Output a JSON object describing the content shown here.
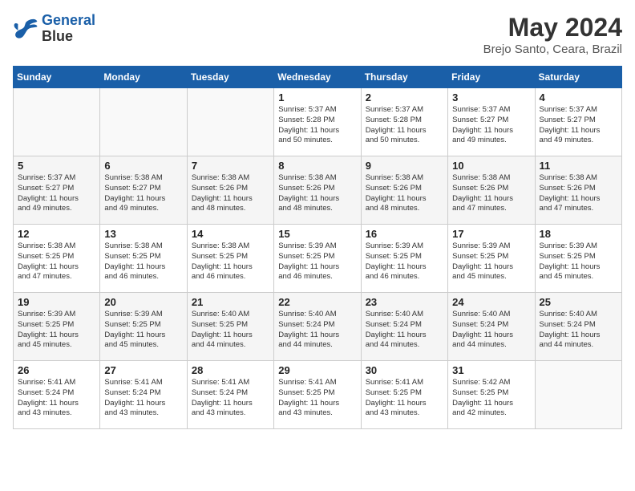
{
  "header": {
    "logo_line1": "General",
    "logo_line2": "Blue",
    "month": "May 2024",
    "location": "Brejo Santo, Ceara, Brazil"
  },
  "days_of_week": [
    "Sunday",
    "Monday",
    "Tuesday",
    "Wednesday",
    "Thursday",
    "Friday",
    "Saturday"
  ],
  "weeks": [
    [
      {
        "day": "",
        "content": ""
      },
      {
        "day": "",
        "content": ""
      },
      {
        "day": "",
        "content": ""
      },
      {
        "day": "1",
        "content": "Sunrise: 5:37 AM\nSunset: 5:28 PM\nDaylight: 11 hours\nand 50 minutes."
      },
      {
        "day": "2",
        "content": "Sunrise: 5:37 AM\nSunset: 5:28 PM\nDaylight: 11 hours\nand 50 minutes."
      },
      {
        "day": "3",
        "content": "Sunrise: 5:37 AM\nSunset: 5:27 PM\nDaylight: 11 hours\nand 49 minutes."
      },
      {
        "day": "4",
        "content": "Sunrise: 5:37 AM\nSunset: 5:27 PM\nDaylight: 11 hours\nand 49 minutes."
      }
    ],
    [
      {
        "day": "5",
        "content": "Sunrise: 5:37 AM\nSunset: 5:27 PM\nDaylight: 11 hours\nand 49 minutes."
      },
      {
        "day": "6",
        "content": "Sunrise: 5:38 AM\nSunset: 5:27 PM\nDaylight: 11 hours\nand 49 minutes."
      },
      {
        "day": "7",
        "content": "Sunrise: 5:38 AM\nSunset: 5:26 PM\nDaylight: 11 hours\nand 48 minutes."
      },
      {
        "day": "8",
        "content": "Sunrise: 5:38 AM\nSunset: 5:26 PM\nDaylight: 11 hours\nand 48 minutes."
      },
      {
        "day": "9",
        "content": "Sunrise: 5:38 AM\nSunset: 5:26 PM\nDaylight: 11 hours\nand 48 minutes."
      },
      {
        "day": "10",
        "content": "Sunrise: 5:38 AM\nSunset: 5:26 PM\nDaylight: 11 hours\nand 47 minutes."
      },
      {
        "day": "11",
        "content": "Sunrise: 5:38 AM\nSunset: 5:26 PM\nDaylight: 11 hours\nand 47 minutes."
      }
    ],
    [
      {
        "day": "12",
        "content": "Sunrise: 5:38 AM\nSunset: 5:25 PM\nDaylight: 11 hours\nand 47 minutes."
      },
      {
        "day": "13",
        "content": "Sunrise: 5:38 AM\nSunset: 5:25 PM\nDaylight: 11 hours\nand 46 minutes."
      },
      {
        "day": "14",
        "content": "Sunrise: 5:38 AM\nSunset: 5:25 PM\nDaylight: 11 hours\nand 46 minutes."
      },
      {
        "day": "15",
        "content": "Sunrise: 5:39 AM\nSunset: 5:25 PM\nDaylight: 11 hours\nand 46 minutes."
      },
      {
        "day": "16",
        "content": "Sunrise: 5:39 AM\nSunset: 5:25 PM\nDaylight: 11 hours\nand 46 minutes."
      },
      {
        "day": "17",
        "content": "Sunrise: 5:39 AM\nSunset: 5:25 PM\nDaylight: 11 hours\nand 45 minutes."
      },
      {
        "day": "18",
        "content": "Sunrise: 5:39 AM\nSunset: 5:25 PM\nDaylight: 11 hours\nand 45 minutes."
      }
    ],
    [
      {
        "day": "19",
        "content": "Sunrise: 5:39 AM\nSunset: 5:25 PM\nDaylight: 11 hours\nand 45 minutes."
      },
      {
        "day": "20",
        "content": "Sunrise: 5:39 AM\nSunset: 5:25 PM\nDaylight: 11 hours\nand 45 minutes."
      },
      {
        "day": "21",
        "content": "Sunrise: 5:40 AM\nSunset: 5:25 PM\nDaylight: 11 hours\nand 44 minutes."
      },
      {
        "day": "22",
        "content": "Sunrise: 5:40 AM\nSunset: 5:24 PM\nDaylight: 11 hours\nand 44 minutes."
      },
      {
        "day": "23",
        "content": "Sunrise: 5:40 AM\nSunset: 5:24 PM\nDaylight: 11 hours\nand 44 minutes."
      },
      {
        "day": "24",
        "content": "Sunrise: 5:40 AM\nSunset: 5:24 PM\nDaylight: 11 hours\nand 44 minutes."
      },
      {
        "day": "25",
        "content": "Sunrise: 5:40 AM\nSunset: 5:24 PM\nDaylight: 11 hours\nand 44 minutes."
      }
    ],
    [
      {
        "day": "26",
        "content": "Sunrise: 5:41 AM\nSunset: 5:24 PM\nDaylight: 11 hours\nand 43 minutes."
      },
      {
        "day": "27",
        "content": "Sunrise: 5:41 AM\nSunset: 5:24 PM\nDaylight: 11 hours\nand 43 minutes."
      },
      {
        "day": "28",
        "content": "Sunrise: 5:41 AM\nSunset: 5:24 PM\nDaylight: 11 hours\nand 43 minutes."
      },
      {
        "day": "29",
        "content": "Sunrise: 5:41 AM\nSunset: 5:25 PM\nDaylight: 11 hours\nand 43 minutes."
      },
      {
        "day": "30",
        "content": "Sunrise: 5:41 AM\nSunset: 5:25 PM\nDaylight: 11 hours\nand 43 minutes."
      },
      {
        "day": "31",
        "content": "Sunrise: 5:42 AM\nSunset: 5:25 PM\nDaylight: 11 hours\nand 42 minutes."
      },
      {
        "day": "",
        "content": ""
      }
    ]
  ]
}
